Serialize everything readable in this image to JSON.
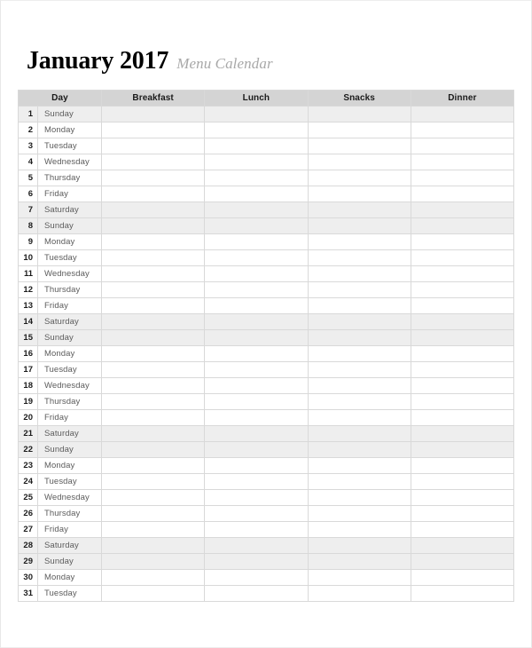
{
  "document": {
    "title_main": "January 2017",
    "title_sub": "Menu Calendar"
  },
  "table": {
    "columns": [
      {
        "key": "num",
        "label": "",
        "span": 2
      },
      {
        "key": "day",
        "label": "Day"
      },
      {
        "key": "breakfast",
        "label": "Breakfast"
      },
      {
        "key": "lunch",
        "label": "Lunch"
      },
      {
        "key": "snacks",
        "label": "Snacks"
      },
      {
        "key": "dinner",
        "label": "Dinner"
      }
    ],
    "headers": [
      "Day",
      "Breakfast",
      "Lunch",
      "Snacks",
      "Dinner"
    ],
    "weekend_days": [
      "Saturday",
      "Sunday"
    ],
    "colors": {
      "header_background": "#d4d4d4",
      "weekend_row": "#eeeeee",
      "weekday_row": "#ffffff",
      "gridline": "#d9d9d9",
      "title_accent": "#a8a8a8"
    },
    "rows": [
      {
        "num": "1",
        "day": "Sunday",
        "breakfast": "",
        "lunch": "",
        "snacks": "",
        "dinner": ""
      },
      {
        "num": "2",
        "day": "Monday",
        "breakfast": "",
        "lunch": "",
        "snacks": "",
        "dinner": ""
      },
      {
        "num": "3",
        "day": "Tuesday",
        "breakfast": "",
        "lunch": "",
        "snacks": "",
        "dinner": ""
      },
      {
        "num": "4",
        "day": "Wednesday",
        "breakfast": "",
        "lunch": "",
        "snacks": "",
        "dinner": ""
      },
      {
        "num": "5",
        "day": "Thursday",
        "breakfast": "",
        "lunch": "",
        "snacks": "",
        "dinner": ""
      },
      {
        "num": "6",
        "day": "Friday",
        "breakfast": "",
        "lunch": "",
        "snacks": "",
        "dinner": ""
      },
      {
        "num": "7",
        "day": "Saturday",
        "breakfast": "",
        "lunch": "",
        "snacks": "",
        "dinner": ""
      },
      {
        "num": "8",
        "day": "Sunday",
        "breakfast": "",
        "lunch": "",
        "snacks": "",
        "dinner": ""
      },
      {
        "num": "9",
        "day": "Monday",
        "breakfast": "",
        "lunch": "",
        "snacks": "",
        "dinner": ""
      },
      {
        "num": "10",
        "day": "Tuesday",
        "breakfast": "",
        "lunch": "",
        "snacks": "",
        "dinner": ""
      },
      {
        "num": "11",
        "day": "Wednesday",
        "breakfast": "",
        "lunch": "",
        "snacks": "",
        "dinner": ""
      },
      {
        "num": "12",
        "day": "Thursday",
        "breakfast": "",
        "lunch": "",
        "snacks": "",
        "dinner": ""
      },
      {
        "num": "13",
        "day": "Friday",
        "breakfast": "",
        "lunch": "",
        "snacks": "",
        "dinner": ""
      },
      {
        "num": "14",
        "day": "Saturday",
        "breakfast": "",
        "lunch": "",
        "snacks": "",
        "dinner": ""
      },
      {
        "num": "15",
        "day": "Sunday",
        "breakfast": "",
        "lunch": "",
        "snacks": "",
        "dinner": ""
      },
      {
        "num": "16",
        "day": "Monday",
        "breakfast": "",
        "lunch": "",
        "snacks": "",
        "dinner": ""
      },
      {
        "num": "17",
        "day": "Tuesday",
        "breakfast": "",
        "lunch": "",
        "snacks": "",
        "dinner": ""
      },
      {
        "num": "18",
        "day": "Wednesday",
        "breakfast": "",
        "lunch": "",
        "snacks": "",
        "dinner": ""
      },
      {
        "num": "19",
        "day": "Thursday",
        "breakfast": "",
        "lunch": "",
        "snacks": "",
        "dinner": ""
      },
      {
        "num": "20",
        "day": "Friday",
        "breakfast": "",
        "lunch": "",
        "snacks": "",
        "dinner": ""
      },
      {
        "num": "21",
        "day": "Saturday",
        "breakfast": "",
        "lunch": "",
        "snacks": "",
        "dinner": ""
      },
      {
        "num": "22",
        "day": "Sunday",
        "breakfast": "",
        "lunch": "",
        "snacks": "",
        "dinner": ""
      },
      {
        "num": "23",
        "day": "Monday",
        "breakfast": "",
        "lunch": "",
        "snacks": "",
        "dinner": ""
      },
      {
        "num": "24",
        "day": "Tuesday",
        "breakfast": "",
        "lunch": "",
        "snacks": "",
        "dinner": ""
      },
      {
        "num": "25",
        "day": "Wednesday",
        "breakfast": "",
        "lunch": "",
        "snacks": "",
        "dinner": ""
      },
      {
        "num": "26",
        "day": "Thursday",
        "breakfast": "",
        "lunch": "",
        "snacks": "",
        "dinner": ""
      },
      {
        "num": "27",
        "day": "Friday",
        "breakfast": "",
        "lunch": "",
        "snacks": "",
        "dinner": ""
      },
      {
        "num": "28",
        "day": "Saturday",
        "breakfast": "",
        "lunch": "",
        "snacks": "",
        "dinner": ""
      },
      {
        "num": "29",
        "day": "Sunday",
        "breakfast": "",
        "lunch": "",
        "snacks": "",
        "dinner": ""
      },
      {
        "num": "30",
        "day": "Monday",
        "breakfast": "",
        "lunch": "",
        "snacks": "",
        "dinner": ""
      },
      {
        "num": "31",
        "day": "Tuesday",
        "breakfast": "",
        "lunch": "",
        "snacks": "",
        "dinner": ""
      }
    ]
  }
}
